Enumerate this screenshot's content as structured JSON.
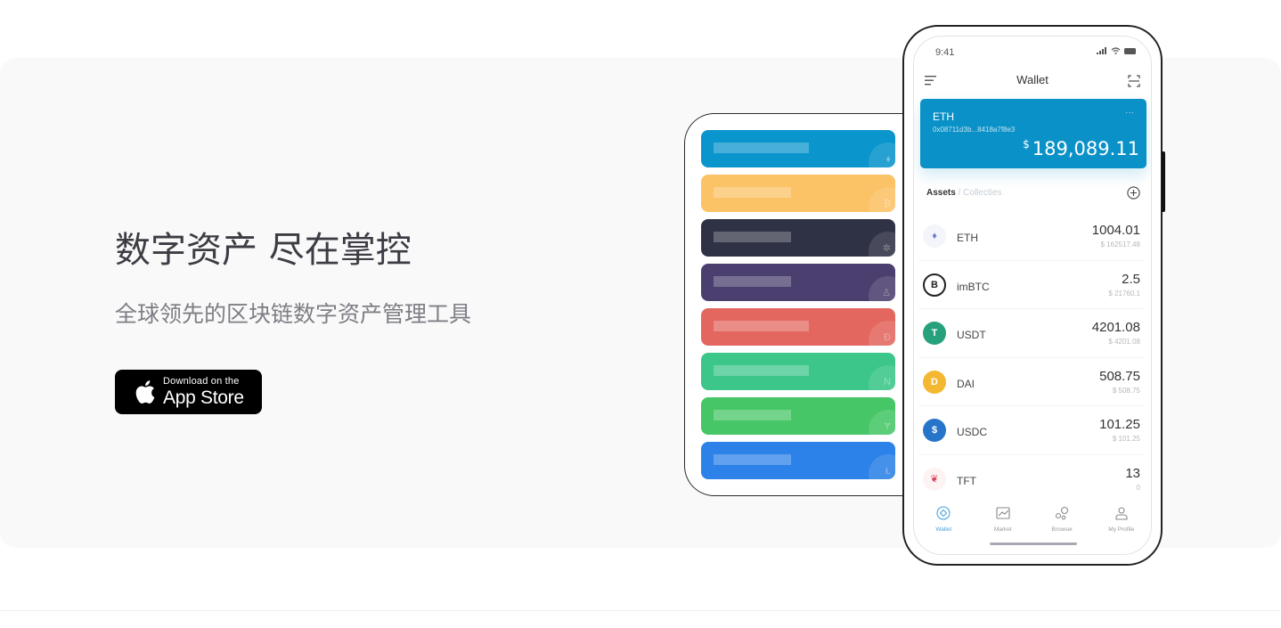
{
  "hero": {
    "headline": "数字资产 尽在掌控",
    "subline": "全球领先的区块链数字资产管理工具",
    "appstore": {
      "small": "Download on the",
      "big": "App Store",
      "icon": "apple-icon"
    }
  },
  "back_device": {
    "cards": [
      {
        "color": "#0a95cc",
        "glyph": "♦",
        "bar": 0.49
      },
      {
        "color": "#fbc266",
        "glyph": "₿",
        "bar": 0.4
      },
      {
        "color": "#2f3245",
        "glyph": "✲",
        "bar": 0.4
      },
      {
        "color": "#4a3f6e",
        "glyph": "♙",
        "bar": 0.4
      },
      {
        "color": "#e3675f",
        "glyph": "Ð",
        "bar": 0.49
      },
      {
        "color": "#3cc68a",
        "glyph": "N",
        "bar": 0.49
      },
      {
        "color": "#46c666",
        "glyph": "Ɏ",
        "bar": 0.4
      },
      {
        "color": "#2c82e8",
        "glyph": "Ł",
        "bar": 0.4
      }
    ]
  },
  "phone": {
    "time": "9:41",
    "title": "Wallet",
    "card": {
      "name": "ETH",
      "address": "0x08711d3b...8418a7f8e3",
      "more": "···",
      "currency": "$",
      "balance": "189,089.11",
      "color": "#0a91c7"
    },
    "tabs": {
      "active": "Assets",
      "sep": "/",
      "inactive": "Collecties"
    },
    "assets": [
      {
        "symbol": "ETH",
        "amount": "1004.01",
        "usd": "$ 162517.48",
        "icon_bg": "#f4f5fb",
        "icon_fg": "#6f7ccf",
        "glyph": "♦"
      },
      {
        "symbol": "imBTC",
        "amount": "2.5",
        "usd": "$ 21760.1",
        "icon_bg": "#ffffff",
        "icon_fg": "#222222",
        "glyph": "B"
      },
      {
        "symbol": "USDT",
        "amount": "4201.08",
        "usd": "$ 4201.08",
        "icon_bg": "#26a17b",
        "icon_fg": "#ffffff",
        "glyph": "T"
      },
      {
        "symbol": "DAI",
        "amount": "508.75",
        "usd": "$ 508.75",
        "icon_bg": "#f4b731",
        "icon_fg": "#ffffff",
        "glyph": "D"
      },
      {
        "symbol": "USDC",
        "amount": "101.25",
        "usd": "$ 101.25",
        "icon_bg": "#2775ca",
        "icon_fg": "#ffffff",
        "glyph": "$"
      },
      {
        "symbol": "TFT",
        "amount": "13",
        "usd": "0",
        "icon_bg": "#fdf3f3",
        "icon_fg": "#d9435b",
        "glyph": "❦"
      }
    ],
    "tabbar": [
      {
        "label": "Wallet",
        "icon": "wallet-icon",
        "active": true
      },
      {
        "label": "Market",
        "icon": "market-chart-icon",
        "active": false
      },
      {
        "label": "Browser",
        "icon": "browser-bubbles-icon",
        "active": false
      },
      {
        "label": "My Profile",
        "icon": "profile-icon",
        "active": false
      }
    ]
  }
}
